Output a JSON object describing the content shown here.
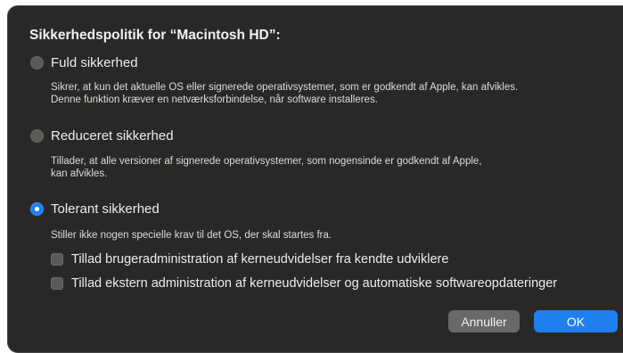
{
  "dialog": {
    "title": "Sikkerhedspolitik for “Macintosh HD”:"
  },
  "options": [
    {
      "label": "Fuld sikkerhed",
      "selected": false,
      "description_lines": [
        "Sikrer, at kun det aktuelle OS eller signerede operativsystemer, som er godkendt af Apple, kan afvikles.",
        "Denne funktion kræver en netværksforbindelse, når software installeres."
      ]
    },
    {
      "label": "Reduceret sikkerhed",
      "selected": false,
      "description_lines": [
        "Tillader, at alle versioner af signerede operativsystemer, som nogensinde er godkendt af Apple,",
        "kan afvikles."
      ]
    },
    {
      "label": "Tolerant sikkerhed",
      "selected": true,
      "description_lines": [
        "Stiller ikke nogen specielle krav til det OS, der skal startes fra."
      ]
    }
  ],
  "checkboxes": [
    {
      "label": "Tillad brugeradministration af kerneudvidelser fra kendte udviklere",
      "checked": false
    },
    {
      "label": "Tillad ekstern administration af kerneudvidelser og automatiske softwareopdateringer",
      "checked": false
    }
  ],
  "buttons": {
    "cancel": "Annuller",
    "ok": "OK"
  },
  "colors": {
    "accent": "#1f7ff1",
    "dialog_background": "#2a2826"
  }
}
